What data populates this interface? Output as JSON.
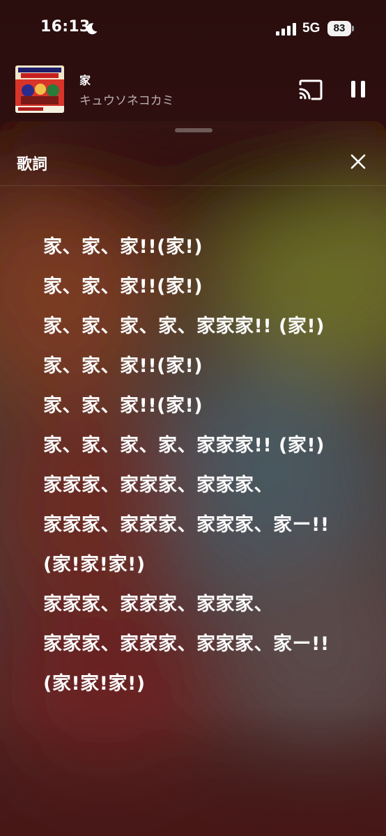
{
  "status_bar": {
    "time": "16:13",
    "network": "5G",
    "battery": "83"
  },
  "now_playing": {
    "title": "家",
    "artist": "キュウソネコカミ"
  },
  "sheet": {
    "title": "歌詞"
  },
  "lyrics": [
    "家、家、家!!(家!)",
    "家、家、家!!(家!)",
    "家、家、家、家、家家家!! (家!)",
    "家、家、家!!(家!)",
    "家、家、家!!(家!)",
    "家、家、家、家、家家家!! (家!)",
    "家家家、家家家、家家家、",
    "家家家、家家家、家家家、家ー!!",
    "(家!家!家!)",
    "家家家、家家家、家家家、",
    "家家家、家家家、家家家、家ー!!",
    "(家!家!家!)"
  ],
  "colors": {
    "accent_red": "#cc2a24",
    "sheet_bg": "#301a16"
  },
  "icons": [
    "moon-icon",
    "signal-icon",
    "cast-icon",
    "pause-icon",
    "close-icon"
  ]
}
